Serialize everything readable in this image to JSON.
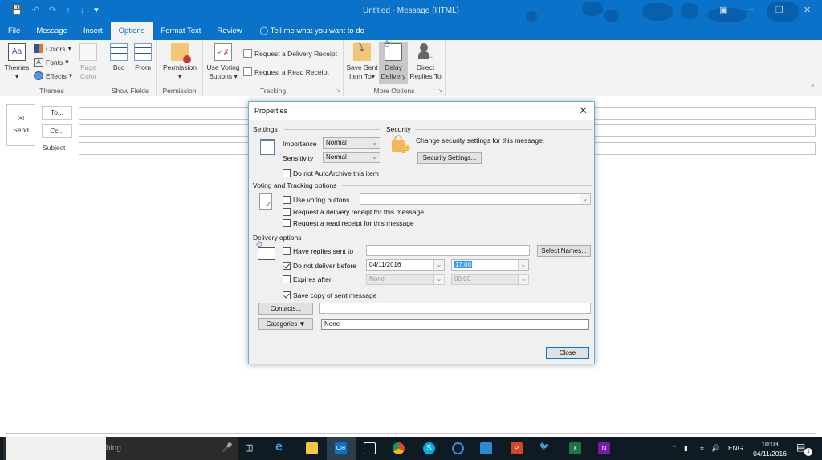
{
  "window": {
    "title": "Untitled  -  Message (HTML)",
    "quick_access": [
      "save-icon",
      "undo-icon",
      "redo-icon",
      "up-arrow-icon",
      "down-arrow-icon",
      "customize-icon"
    ]
  },
  "tabs": [
    {
      "label": "File"
    },
    {
      "label": "Message"
    },
    {
      "label": "Insert"
    },
    {
      "label": "Options",
      "active": true
    },
    {
      "label": "Format Text"
    },
    {
      "label": "Review"
    }
  ],
  "tell_me": "Tell me what you want to do",
  "ribbon": {
    "themes": {
      "themes_label": "Themes",
      "colors_label": "Colors",
      "fonts_label": "Fonts",
      "effects_label": "Effects",
      "page_color_label_1": "Page",
      "page_color_label_2": "Color",
      "group_label": "Themes"
    },
    "show_fields": {
      "bcc_label": "Bcc",
      "from_label": "From",
      "group_label": "Show Fields"
    },
    "permission": {
      "permission_label": "Permission",
      "group_label": "Permission"
    },
    "tracking": {
      "voting_label_1": "Use Voting",
      "voting_label_2": "Buttons",
      "delivery_receipt_label": "Request a Delivery Receipt",
      "read_receipt_label": "Request a Read Receipt",
      "group_label": "Tracking"
    },
    "more_options": {
      "save_sent_1": "Save Sent",
      "save_sent_2": "Item To",
      "delay_1": "Delay",
      "delay_2": "Delivery",
      "direct_1": "Direct",
      "direct_2": "Replies To",
      "group_label": "More Options"
    }
  },
  "compose": {
    "send_label": "Send",
    "to_label": "To...",
    "cc_label": "Cc...",
    "subject_label": "Subject",
    "to_value": "",
    "cc_value": "",
    "subject_value": ""
  },
  "dialog": {
    "title": "Properties",
    "settings_header": "Settings",
    "importance_label": "Importance",
    "importance_value": "Normal",
    "sensitivity_label": "Sensitivity",
    "sensitivity_value": "Normal",
    "no_autoarchive_label": "Do not AutoArchive this item",
    "security_header": "Security",
    "security_text": "Change security settings for this message.",
    "security_button": "Security Settings...",
    "voting_header": "Voting and Tracking options",
    "use_voting_label": "Use voting buttons",
    "voting_value": "",
    "delivery_receipt_label": "Request a delivery receipt for this message",
    "read_receipt_label": "Request a read receipt for this message",
    "delivery_header": "Delivery options",
    "replies_label": "Have replies sent to",
    "replies_value": "",
    "select_names_button": "Select Names...",
    "do_not_deliver_label": "Do not deliver before",
    "deliver_date": "04/11/2016",
    "deliver_time": "17:00",
    "expires_label": "Expires after",
    "expires_date": "None",
    "expires_time": "00:00",
    "save_copy_label": "Save copy of sent message",
    "contacts_button": "Contacts...",
    "contacts_value": "",
    "categories_button": "Categories",
    "categories_value": "None",
    "close_button": "Close"
  },
  "taskbar": {
    "search_text": "hing",
    "apps": [
      "task-view",
      "edge",
      "file-explorer",
      "outlook",
      "store",
      "chrome",
      "skype",
      "cortana-app",
      "app-blue",
      "powerpoint",
      "gimp",
      "excel",
      "onenote"
    ],
    "language": "ENG",
    "time": "10:03",
    "date": "04/11/2016",
    "notification_count": "1"
  }
}
